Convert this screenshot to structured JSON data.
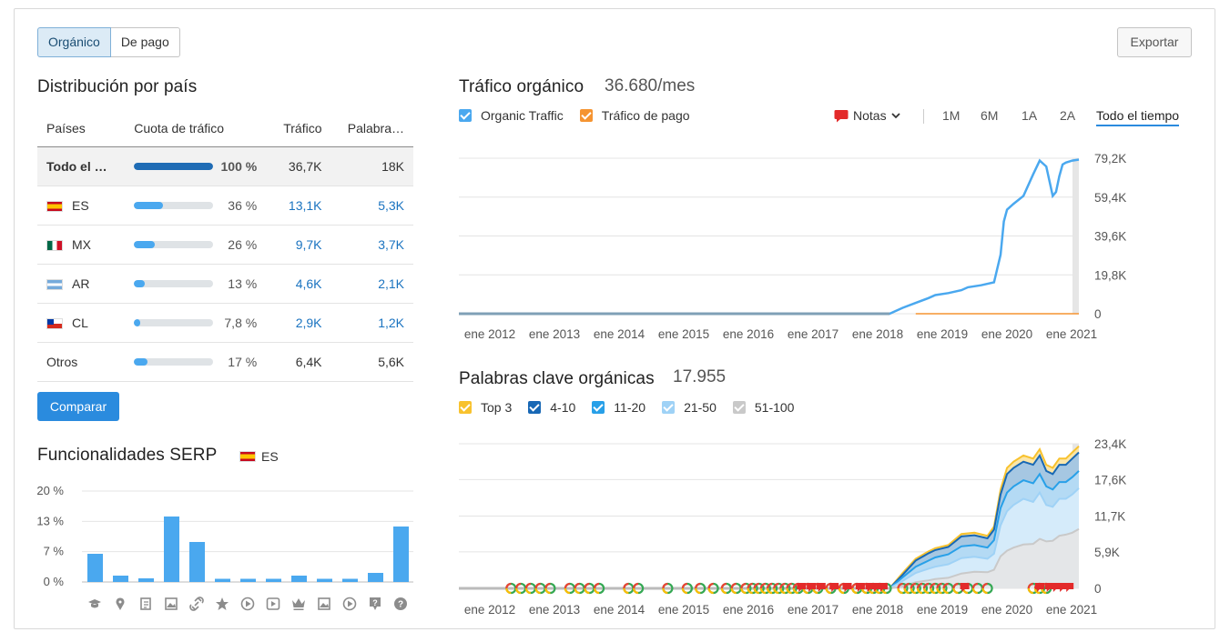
{
  "toolbar": {
    "tabs": [
      {
        "label": "Orgánico",
        "active": true
      },
      {
        "label": "De pago",
        "active": false
      }
    ],
    "export_label": "Exportar"
  },
  "country_distribution": {
    "title": "Distribución por país",
    "columns": [
      "Países",
      "Cuota de tráfico",
      "Tráfico",
      "Palabra…"
    ],
    "rows": [
      {
        "country": "Todo el …",
        "flag": "",
        "share_pct": 100,
        "share_label": "100 %",
        "traffic": "36,7K",
        "keywords": "18K"
      },
      {
        "country": "ES",
        "flag": "es",
        "share_pct": 36,
        "share_label": "36 %",
        "traffic": "13,1K",
        "keywords": "5,3K"
      },
      {
        "country": "MX",
        "flag": "mx",
        "share_pct": 26,
        "share_label": "26 %",
        "traffic": "9,7K",
        "keywords": "3,7K"
      },
      {
        "country": "AR",
        "flag": "ar",
        "share_pct": 13,
        "share_label": "13 %",
        "traffic": "4,6K",
        "keywords": "2,1K"
      },
      {
        "country": "CL",
        "flag": "cl",
        "share_pct": 7.8,
        "share_label": "7,8 %",
        "traffic": "2,9K",
        "keywords": "1,2K"
      },
      {
        "country": "Otros",
        "flag": "",
        "share_pct": 17,
        "share_label": "17 %",
        "traffic": "6,4K",
        "keywords": "5,6K"
      }
    ],
    "compare_label": "Comparar"
  },
  "serp_features": {
    "title": "Funcionalidades SERP",
    "country": "ES",
    "icons": [
      "graduation-cap-icon",
      "map-pin-icon",
      "document-icon",
      "image-icon",
      "link-icon",
      "star-icon",
      "play-icon",
      "video-icon",
      "crown-icon",
      "image-icon",
      "play-icon",
      "question-icon",
      "help-icon"
    ]
  },
  "organic_traffic": {
    "title": "Tráfico orgánico",
    "value": "36.680/mes",
    "legend": [
      {
        "label": "Organic Traffic",
        "color": "#4aa8ef"
      },
      {
        "label": "Tráfico de pago",
        "color": "#f59431"
      }
    ],
    "notes_label": "Notas",
    "ranges": [
      "1M",
      "6M",
      "1A",
      "2A",
      "Todo el tiempo"
    ],
    "active_range": "Todo el tiempo"
  },
  "organic_keywords": {
    "title": "Palabras clave orgánicas",
    "value": "17.955",
    "legend": [
      {
        "label": "Top 3",
        "color": "#f8c22e"
      },
      {
        "label": "4-10",
        "color": "#1868b5"
      },
      {
        "label": "11-20",
        "color": "#28a0e8"
      },
      {
        "label": "21-50",
        "color": "#9fd2f6"
      },
      {
        "label": "51-100",
        "color": "#c9c9c9"
      }
    ]
  },
  "chart_data": [
    {
      "type": "bar",
      "title": "Funcionalidades SERP",
      "y_ticks": [
        "20 %",
        "13 %",
        "7 %",
        "0 %"
      ],
      "ylim": [
        0,
        20
      ],
      "values": [
        6.2,
        1.4,
        0.8,
        14.4,
        8.8,
        0.7,
        0.7,
        0.7,
        1.4,
        0.7,
        0.7,
        2.0,
        12.2
      ],
      "color": "#4aa8ef"
    },
    {
      "type": "line",
      "title": "Tráfico orgánico",
      "x_ticks": [
        "ene 2012",
        "ene 2013",
        "ene 2014",
        "ene 2015",
        "ene 2016",
        "ene 2017",
        "ene 2018",
        "ene 2019",
        "ene 2020",
        "ene 2021"
      ],
      "y_ticks": [
        "79,2K",
        "59,4K",
        "39,6K",
        "19,8K",
        "0"
      ],
      "ylim": [
        0,
        79200
      ],
      "series": [
        {
          "name": "Organic Traffic",
          "color": "#4aa8ef",
          "x": [
            2011.7,
            2018.3,
            2018.5,
            2018.7,
            2018.9,
            2019.0,
            2019.2,
            2019.4,
            2019.5,
            2019.7,
            2019.9,
            2020.0,
            2020.05,
            2020.1,
            2020.2,
            2020.35,
            2020.5,
            2020.6,
            2020.7,
            2020.8,
            2020.85,
            2020.9,
            2020.95,
            2021.0,
            2021.1,
            2021.2
          ],
          "y": [
            0,
            0,
            3000,
            5500,
            8000,
            9500,
            10500,
            12000,
            13500,
            14500,
            16000,
            30000,
            47000,
            53000,
            56000,
            60000,
            71000,
            78000,
            75000,
            60000,
            62000,
            70000,
            76000,
            77000,
            78000,
            78500
          ]
        },
        {
          "name": "Tráfico de pago",
          "color": "#f59431",
          "x": [
            2018.7,
            2021.2
          ],
          "y": [
            0,
            0
          ]
        }
      ]
    },
    {
      "type": "area",
      "title": "Palabras clave orgánicas",
      "x_ticks": [
        "ene 2012",
        "ene 2013",
        "ene 2014",
        "ene 2015",
        "ene 2016",
        "ene 2017",
        "ene 2018",
        "ene 2019",
        "ene 2020",
        "ene 2021"
      ],
      "y_ticks": [
        "23,4K",
        "17,6K",
        "11,7K",
        "5,9K",
        "0"
      ],
      "ylim": [
        0,
        23400
      ],
      "x": [
        2011.7,
        2018.3,
        2018.5,
        2018.7,
        2018.9,
        2019.0,
        2019.2,
        2019.4,
        2019.6,
        2019.8,
        2019.9,
        2020.0,
        2020.1,
        2020.2,
        2020.35,
        2020.5,
        2020.6,
        2020.7,
        2020.8,
        2020.9,
        2021.0,
        2021.1,
        2021.2
      ],
      "series": [
        {
          "name": "Top 3",
          "color": "#f8c22e",
          "values": [
            0,
            0,
            2500,
            4800,
            6000,
            6500,
            7000,
            8800,
            9000,
            8500,
            10000,
            16000,
            19500,
            20500,
            21500,
            21000,
            22500,
            20000,
            19500,
            21000,
            21000,
            22000,
            23000
          ]
        },
        {
          "name": "4-10",
          "color": "#1868b5",
          "values": [
            0,
            0,
            2200,
            4500,
            5700,
            6200,
            6700,
            8400,
            8600,
            8100,
            9500,
            15200,
            18500,
            19500,
            20500,
            20000,
            21500,
            19000,
            18500,
            20000,
            20000,
            21000,
            22000
          ]
        },
        {
          "name": "11-20",
          "color": "#28a0e8",
          "values": [
            0,
            0,
            1800,
            3500,
            4500,
            5000,
            5500,
            6800,
            7000,
            6600,
            7800,
            13000,
            15500,
            16500,
            17500,
            17000,
            18500,
            16500,
            16000,
            17200,
            17200,
            18000,
            19000
          ]
        },
        {
          "name": "21-50",
          "color": "#9fd2f6",
          "values": [
            0,
            0,
            1200,
            2500,
            3200,
            3500,
            3900,
            4900,
            5100,
            4800,
            5600,
            10200,
            12500,
            13500,
            14500,
            14000,
            15500,
            13500,
            13200,
            14500,
            14500,
            15200,
            16200
          ]
        },
        {
          "name": "51-100",
          "color": "#c9c9c9",
          "values": [
            0,
            0,
            300,
            1000,
            1300,
            1500,
            1700,
            2400,
            2700,
            2600,
            3000,
            5200,
            6100,
            6600,
            7100,
            7200,
            8000,
            7600,
            7700,
            8500,
            8700,
            9000,
            9600
          ]
        }
      ]
    }
  ]
}
